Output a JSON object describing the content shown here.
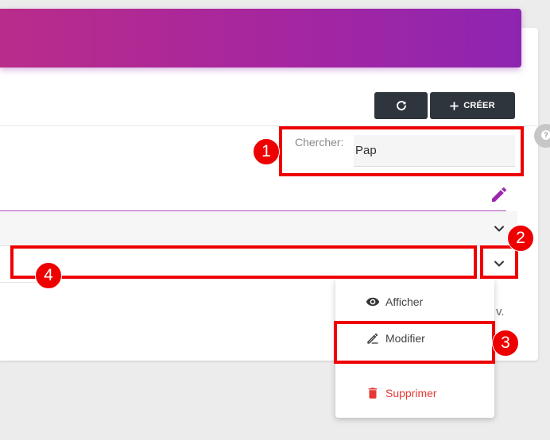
{
  "toolbar": {
    "refresh_icon": "refresh-icon",
    "create_label": "CRÉER",
    "create_icon": "plus-icon"
  },
  "search": {
    "label": "Chercher:",
    "value": "Pap"
  },
  "table": {
    "side_text": "v."
  },
  "row_menu": {
    "items": [
      {
        "label": "Afficher",
        "icon": "eye-icon"
      },
      {
        "label": "Modifier",
        "icon": "pen-icon"
      },
      {
        "label": "Supprimer",
        "icon": "trash-icon"
      }
    ]
  },
  "annotations": {
    "badges": [
      "1",
      "2",
      "3",
      "4"
    ]
  },
  "colors": {
    "header_gradient_start": "#b92c8a",
    "header_gradient_end": "#8e25b1",
    "toolbar_button": "#2f353c",
    "accent_purple": "#9c27b0",
    "delete_red": "#e53935",
    "annotation_red": "#ee0000"
  }
}
